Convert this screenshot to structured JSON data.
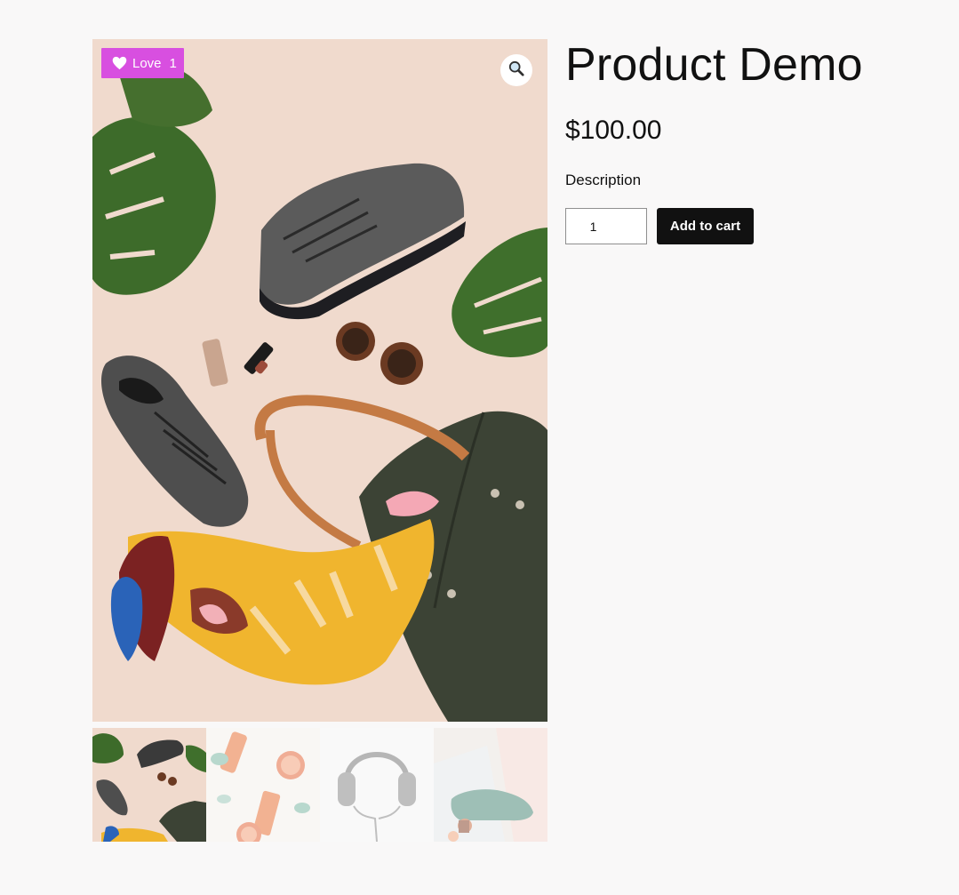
{
  "product": {
    "title": "Product Demo",
    "price": "$100.00",
    "description": "Description"
  },
  "love": {
    "label": "Love",
    "count": "1",
    "color": "#d84fe0"
  },
  "cart": {
    "quantity": "1",
    "button_label": "Add to cart"
  },
  "icons": {
    "zoom": "magnifier-icon",
    "love": "heart-icon"
  },
  "gallery": {
    "thumbnails": [
      {
        "name": "fashion-flatlay",
        "active": true
      },
      {
        "name": "skincare-citrus",
        "active": false
      },
      {
        "name": "headphones",
        "active": false
      },
      {
        "name": "green-shoe",
        "active": false
      }
    ]
  }
}
